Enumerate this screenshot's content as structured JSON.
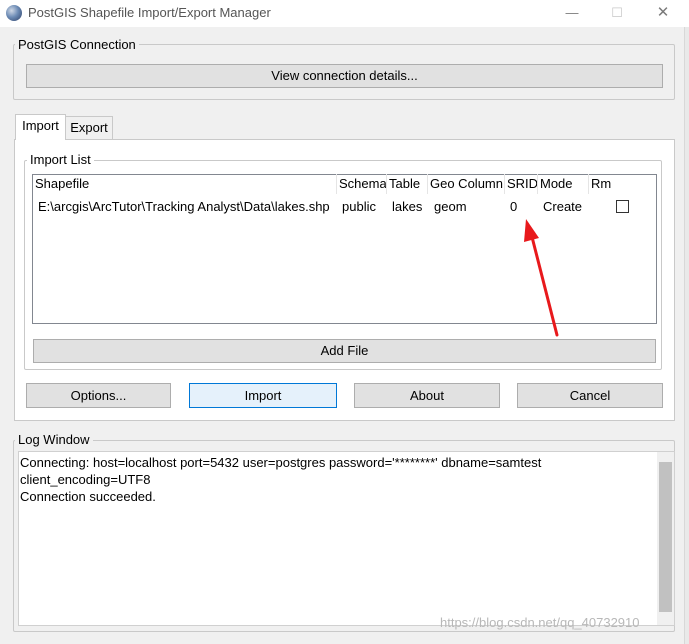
{
  "window": {
    "title": "PostGIS Shapefile Import/Export Manager",
    "controls": {
      "minimize": "—",
      "maximize": "☐",
      "close": "✕"
    }
  },
  "connection_group": {
    "label": "PostGIS Connection",
    "view_details_label": "View connection details..."
  },
  "tabs": [
    {
      "label": "Import",
      "active": true
    },
    {
      "label": "Export",
      "active": false
    }
  ],
  "import_list": {
    "label": "Import List",
    "columns": [
      "Shapefile",
      "Schema",
      "Table",
      "Geo Column",
      "SRID",
      "Mode",
      "Rm"
    ],
    "rows": [
      {
        "shapefile": "E:\\arcgis\\ArcTutor\\Tracking Analyst\\Data\\lakes.shp",
        "schema": "public",
        "table": "lakes",
        "geo_column": "geom",
        "srid": "0",
        "mode": "Create",
        "rm": false
      }
    ],
    "add_file_label": "Add File"
  },
  "actions": {
    "options_label": "Options...",
    "import_label": "Import",
    "about_label": "About",
    "cancel_label": "Cancel"
  },
  "log": {
    "label": "Log Window",
    "lines": [
      "Connecting:  host=localhost port=5432 user=postgres password='********' dbname=samtest",
      "client_encoding=UTF8",
      "Connection succeeded."
    ]
  },
  "watermark": "https://blog.csdn.net/qq_40732910",
  "colors": {
    "annotation_arrow": "#e8191c",
    "default_button_border": "#0078d7"
  },
  "icons": {
    "app": "postgis-globe-icon"
  }
}
